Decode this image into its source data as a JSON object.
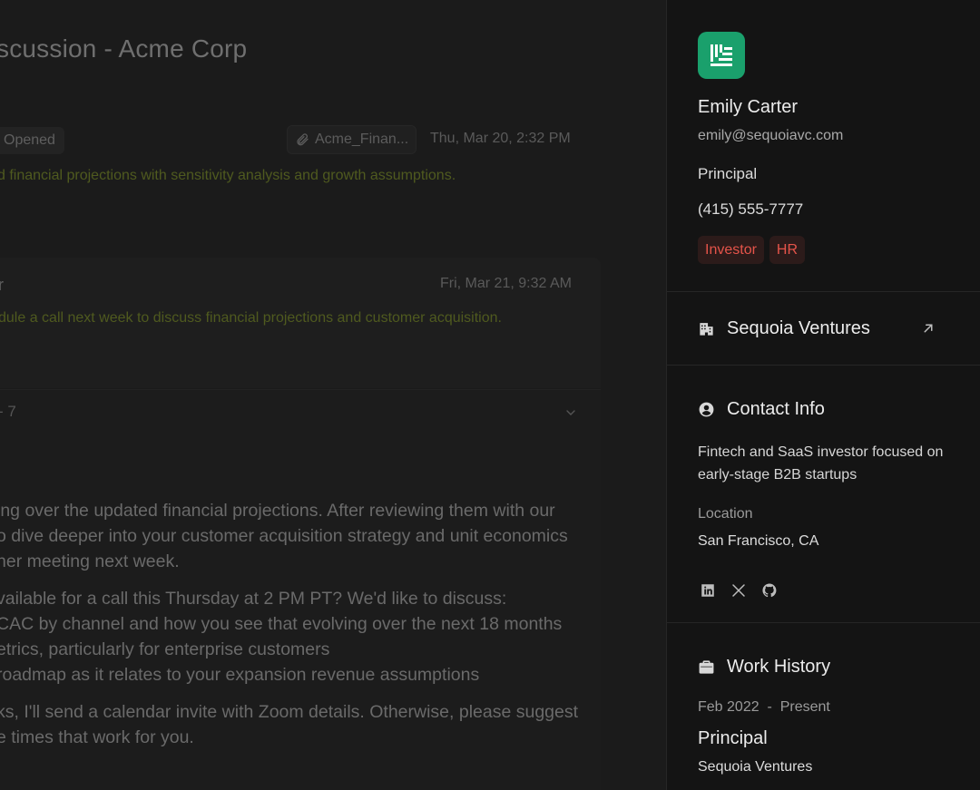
{
  "thread": {
    "title": "scussion - Acme Corp",
    "message1": {
      "status": "Opened",
      "attachment": "Acme_Finan...",
      "date": "Thu, Mar 20, 2:32 PM",
      "summary": "d financial projections with sensitivity analysis and growth assumptions."
    },
    "message2": {
      "sender": "r",
      "date": "Fri, Mar 21, 9:32 AM",
      "summary": "dule a call next week to discuss financial projections and customer acquisition."
    },
    "message3": {
      "collapsed_label": "- 7",
      "body": [
        "ing over the updated financial projections. After reviewing them with our",
        "o dive deeper into your customer acquisition strategy and unit economics",
        "her meeting next week.",
        "vailable for a call this Thursday at 2 PM PT? We'd like to discuss:",
        "CAC by channel and how you see that evolving over the next 18 months",
        "etrics, particularly for enterprise customers",
        "roadmap as it relates to your expansion revenue assumptions",
        "ks, I'll send a calendar invite with Zoom details. Otherwise, please suggest",
        "e times that work for you."
      ]
    }
  },
  "contact": {
    "name": "Emily Carter",
    "email": "emily@sequoiavc.com",
    "title": "Principal",
    "phone": "(415) 555-7777",
    "tags": [
      "Investor",
      "HR"
    ],
    "logo_icon": "ledger-logo-icon",
    "accent_color": "#1aa06c",
    "tag_color": "#e5544a"
  },
  "company": {
    "name": "Sequoia Ventures",
    "icon": "building-icon",
    "link_icon": "arrow-up-right-icon"
  },
  "contact_info": {
    "heading": "Contact Info",
    "description": "Fintech and SaaS investor focused on early-stage B2B startups",
    "location_label": "Location",
    "location": "San Francisco, CA",
    "socials": [
      "linkedin-icon",
      "x-icon",
      "github-icon"
    ]
  },
  "work_history": {
    "heading": "Work History",
    "start": "Feb 2022",
    "separator": "-",
    "end": "Present",
    "role": "Principal",
    "company": "Sequoia Ventures"
  }
}
